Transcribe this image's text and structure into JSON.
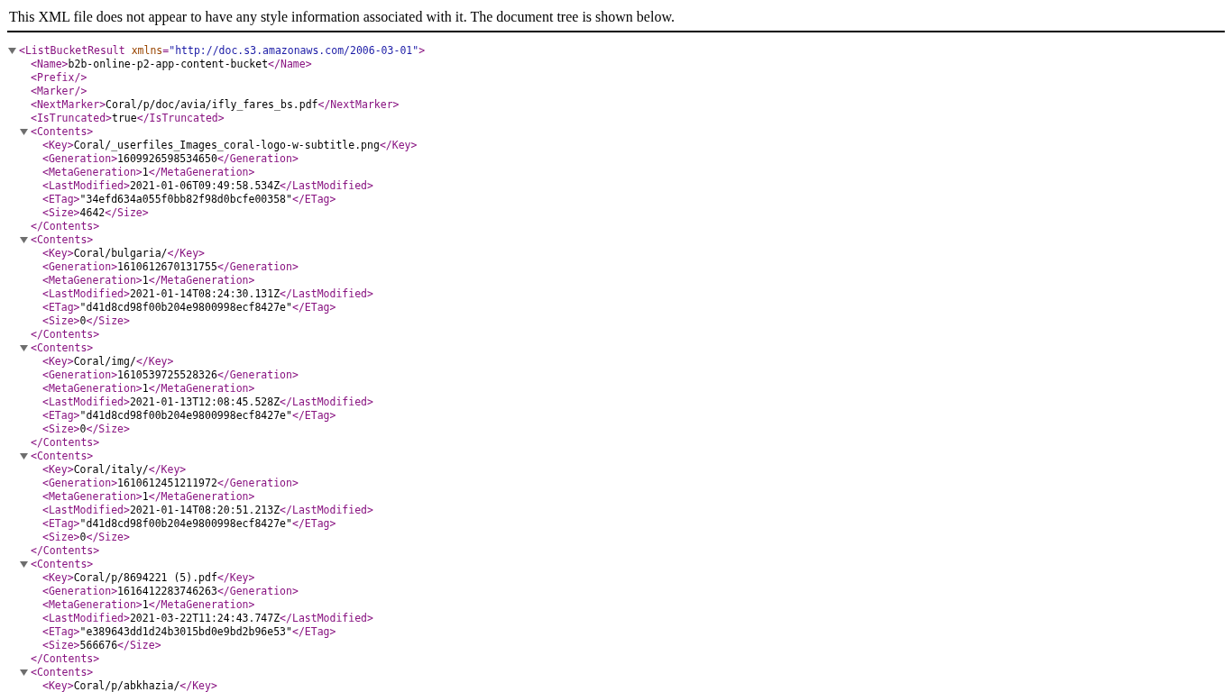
{
  "notice": "This XML file does not appear to have any style information associated with it. The document tree is shown below.",
  "tree": {
    "kind": "element",
    "open": "<ListBucketResult",
    "attr_name": "xmlns",
    "attr_sep": "=",
    "attr_value": "\"http://doc.s3.amazonaws.com/2006-03-01\"",
    "open_end": ">",
    "expanded": true,
    "children": [
      {
        "kind": "leaf",
        "open": "<Name>",
        "text": "b2b-online-p2-app-content-bucket",
        "close": "</Name>"
      },
      {
        "kind": "empty",
        "open": "<Prefix/>"
      },
      {
        "kind": "empty",
        "open": "<Marker/>"
      },
      {
        "kind": "leaf",
        "open": "<NextMarker>",
        "text": "Coral/p/doc/avia/ifly_fares_bs.pdf",
        "close": "</NextMarker>"
      },
      {
        "kind": "leaf",
        "open": "<IsTruncated>",
        "text": "true",
        "close": "</IsTruncated>"
      },
      {
        "kind": "element",
        "open": "<Contents>",
        "expanded": true,
        "close": "</Contents>",
        "children": [
          {
            "kind": "leaf",
            "open": "<Key>",
            "text": "Coral/_userfiles_Images_coral-logo-w-subtitle.png",
            "close": "</Key>"
          },
          {
            "kind": "leaf",
            "open": "<Generation>",
            "text": "1609926598534650",
            "close": "</Generation>"
          },
          {
            "kind": "leaf",
            "open": "<MetaGeneration>",
            "text": "1",
            "close": "</MetaGeneration>"
          },
          {
            "kind": "leaf",
            "open": "<LastModified>",
            "text": "2021-01-06T09:49:58.534Z",
            "close": "</LastModified>"
          },
          {
            "kind": "leaf",
            "open": "<ETag>",
            "text": "\"34efd634a055f0bb82f98d0bcfe00358\"",
            "close": "</ETag>"
          },
          {
            "kind": "leaf",
            "open": "<Size>",
            "text": "4642",
            "close": "</Size>"
          }
        ]
      },
      {
        "kind": "element",
        "open": "<Contents>",
        "expanded": true,
        "close": "</Contents>",
        "children": [
          {
            "kind": "leaf",
            "open": "<Key>",
            "text": "Coral/bulgaria/",
            "close": "</Key>"
          },
          {
            "kind": "leaf",
            "open": "<Generation>",
            "text": "1610612670131755",
            "close": "</Generation>"
          },
          {
            "kind": "leaf",
            "open": "<MetaGeneration>",
            "text": "1",
            "close": "</MetaGeneration>"
          },
          {
            "kind": "leaf",
            "open": "<LastModified>",
            "text": "2021-01-14T08:24:30.131Z",
            "close": "</LastModified>"
          },
          {
            "kind": "leaf",
            "open": "<ETag>",
            "text": "\"d41d8cd98f00b204e9800998ecf8427e\"",
            "close": "</ETag>"
          },
          {
            "kind": "leaf",
            "open": "<Size>",
            "text": "0",
            "close": "</Size>"
          }
        ]
      },
      {
        "kind": "element",
        "open": "<Contents>",
        "expanded": true,
        "close": "</Contents>",
        "children": [
          {
            "kind": "leaf",
            "open": "<Key>",
            "text": "Coral/img/",
            "close": "</Key>"
          },
          {
            "kind": "leaf",
            "open": "<Generation>",
            "text": "1610539725528326",
            "close": "</Generation>"
          },
          {
            "kind": "leaf",
            "open": "<MetaGeneration>",
            "text": "1",
            "close": "</MetaGeneration>"
          },
          {
            "kind": "leaf",
            "open": "<LastModified>",
            "text": "2021-01-13T12:08:45.528Z",
            "close": "</LastModified>"
          },
          {
            "kind": "leaf",
            "open": "<ETag>",
            "text": "\"d41d8cd98f00b204e9800998ecf8427e\"",
            "close": "</ETag>"
          },
          {
            "kind": "leaf",
            "open": "<Size>",
            "text": "0",
            "close": "</Size>"
          }
        ]
      },
      {
        "kind": "element",
        "open": "<Contents>",
        "expanded": true,
        "close": "</Contents>",
        "children": [
          {
            "kind": "leaf",
            "open": "<Key>",
            "text": "Coral/italy/",
            "close": "</Key>"
          },
          {
            "kind": "leaf",
            "open": "<Generation>",
            "text": "1610612451211972",
            "close": "</Generation>"
          },
          {
            "kind": "leaf",
            "open": "<MetaGeneration>",
            "text": "1",
            "close": "</MetaGeneration>"
          },
          {
            "kind": "leaf",
            "open": "<LastModified>",
            "text": "2021-01-14T08:20:51.213Z",
            "close": "</LastModified>"
          },
          {
            "kind": "leaf",
            "open": "<ETag>",
            "text": "\"d41d8cd98f00b204e9800998ecf8427e\"",
            "close": "</ETag>"
          },
          {
            "kind": "leaf",
            "open": "<Size>",
            "text": "0",
            "close": "</Size>"
          }
        ]
      },
      {
        "kind": "element",
        "open": "<Contents>",
        "expanded": true,
        "close": "</Contents>",
        "children": [
          {
            "kind": "leaf",
            "open": "<Key>",
            "text": "Coral/p/8694221 (5).pdf",
            "close": "</Key>"
          },
          {
            "kind": "leaf",
            "open": "<Generation>",
            "text": "1616412283746263",
            "close": "</Generation>"
          },
          {
            "kind": "leaf",
            "open": "<MetaGeneration>",
            "text": "1",
            "close": "</MetaGeneration>"
          },
          {
            "kind": "leaf",
            "open": "<LastModified>",
            "text": "2021-03-22T11:24:43.747Z",
            "close": "</LastModified>"
          },
          {
            "kind": "leaf",
            "open": "<ETag>",
            "text": "\"e389643dd1d24b3015bd0e9bd2b96e53\"",
            "close": "</ETag>"
          },
          {
            "kind": "leaf",
            "open": "<Size>",
            "text": "566676",
            "close": "</Size>"
          }
        ]
      },
      {
        "kind": "element",
        "open": "<Contents>",
        "expanded": true,
        "children": [
          {
            "kind": "leaf",
            "open": "<Key>",
            "text": "Coral/p/abkhazia/",
            "close": "</Key>"
          }
        ]
      }
    ]
  }
}
